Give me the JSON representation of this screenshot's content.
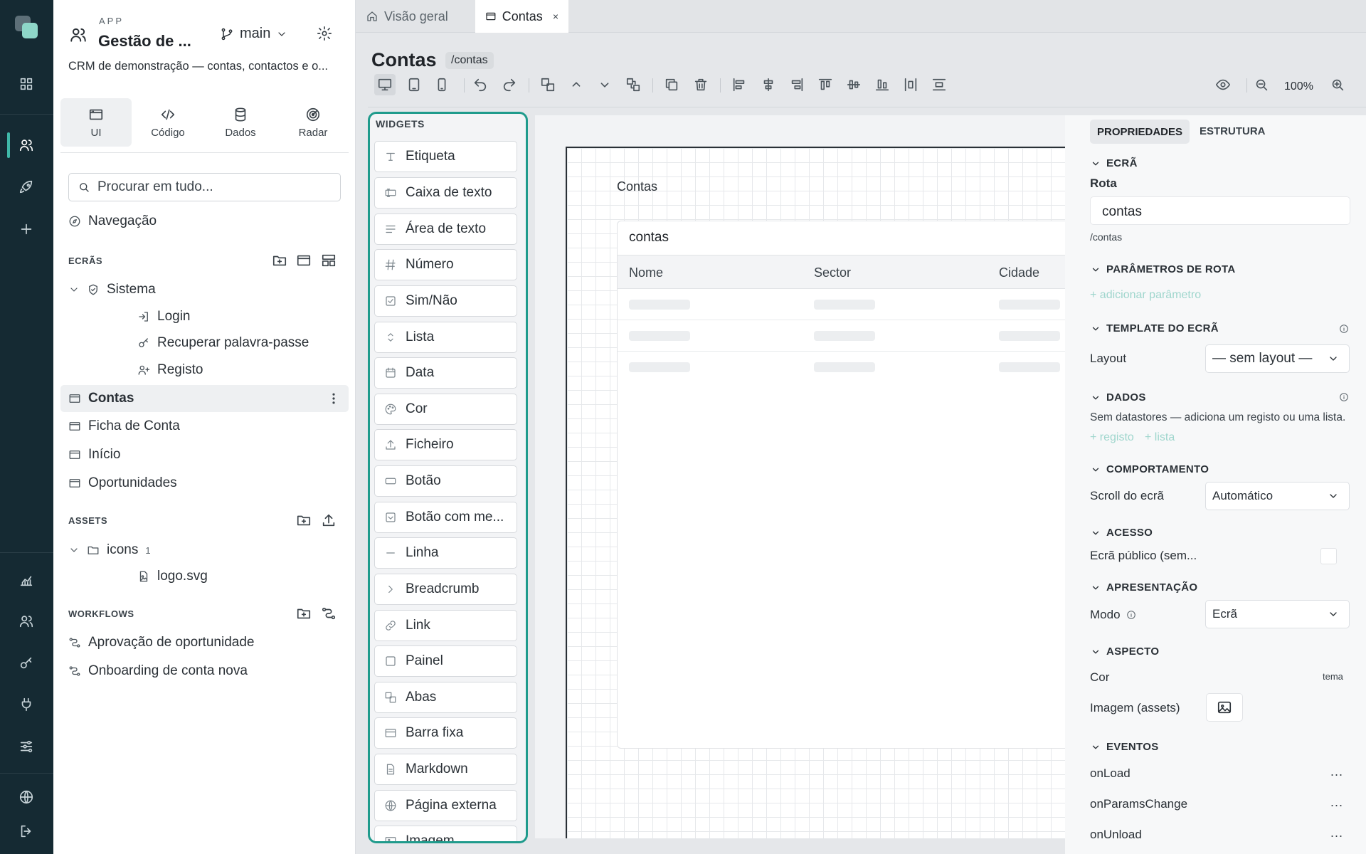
{
  "app": {
    "label": "APP",
    "name": "Gestão de ...",
    "branch": "main",
    "description": "CRM de demonstração — contas, contactos e o..."
  },
  "modes": [
    "UI",
    "Código",
    "Dados",
    "Radar"
  ],
  "search": {
    "placeholder": "Procurar em tudo..."
  },
  "navigation_label": "Navegação",
  "screens": {
    "heading": "ECRÃS",
    "group": "Sistema",
    "system_items": [
      "Login",
      "Recuperar palavra-passe",
      "Registo"
    ],
    "items": [
      "Contas",
      "Ficha de Conta",
      "Início",
      "Oportunidades"
    ]
  },
  "assets": {
    "heading": "ASSETS",
    "folder": "icons",
    "folder_count": "1",
    "file": "logo.svg"
  },
  "workflows": {
    "heading": "WORKFLOWS",
    "items": [
      "Aprovação de oportunidade",
      "Onboarding de conta nova"
    ]
  },
  "tabs": [
    {
      "label": "Visão geral",
      "icon": "home-icon"
    },
    {
      "label": "Contas",
      "icon": "window-icon",
      "close": "×"
    }
  ],
  "page": {
    "title": "Contas",
    "route_badge": "/contas"
  },
  "toolbar": {
    "zoom": "100%"
  },
  "widgets": {
    "heading": "WIDGETS",
    "items": [
      "Etiqueta",
      "Caixa de texto",
      "Área de texto",
      "Número",
      "Sim/Não",
      "Lista",
      "Data",
      "Cor",
      "Ficheiro",
      "Botão",
      "Botão com me...",
      "Linha",
      "Breadcrumb",
      "Link",
      "Painel",
      "Abas",
      "Barra fixa",
      "Markdown",
      "Página externa",
      "Imagem"
    ]
  },
  "canvas": {
    "label": "Contas",
    "table_title": "contas",
    "columns": [
      "Nome",
      "Sector",
      "Cidade"
    ]
  },
  "properties": {
    "tabs": [
      "PROPRIEDADES",
      "ESTRUTURA"
    ],
    "ecra": {
      "heading": "ECRÃ",
      "route_label": "Rota",
      "route_value": "contas",
      "route_hint": "/contas"
    },
    "params": {
      "heading": "PARÂMETROS DE ROTA",
      "add": "+ adicionar parâmetro"
    },
    "template": {
      "heading": "TEMPLATE DO ECRÃ",
      "layout_label": "Layout",
      "layout_value": "— sem layout —"
    },
    "dados": {
      "heading": "DADOS",
      "text": "Sem datastores — adiciona um registo ou uma lista.",
      "add_registo": "+ registo",
      "add_lista": "+ lista"
    },
    "comportamento": {
      "heading": "COMPORTAMENTO",
      "scroll_label": "Scroll do ecrã",
      "scroll_value": "Automático"
    },
    "acesso": {
      "heading": "ACESSO",
      "public_label": "Ecrã público (sem..."
    },
    "apresentacao": {
      "heading": "APRESENTAÇÃO",
      "mode_label": "Modo",
      "mode_value": "Ecrã"
    },
    "aspecto": {
      "heading": "ASPECTO",
      "color_label": "Cor",
      "color_value": "tema",
      "image_label": "Imagem (assets)"
    },
    "eventos": {
      "heading": "EVENTOS",
      "items": [
        "onLoad",
        "onParamsChange",
        "onUnload"
      ],
      "more": "..."
    }
  }
}
